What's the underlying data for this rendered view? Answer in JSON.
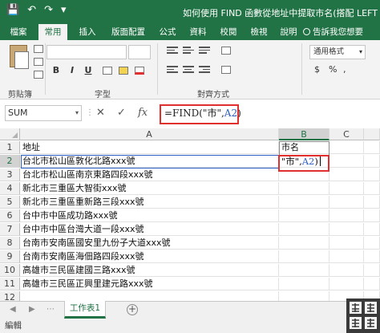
{
  "window": {
    "title": "如何使用 FIND 函數從地址中提取市名(搭配 LEFT",
    "qat_icons": [
      "save-icon",
      "undo-icon",
      "redo-icon",
      "customize-icon"
    ]
  },
  "ribbon_tabs": [
    "檔案",
    "常用",
    "插入",
    "版面配置",
    "公式",
    "資料",
    "校閱",
    "檢視",
    "說明"
  ],
  "active_tab": "常用",
  "tell_me": "告訴我您想要",
  "ribbon": {
    "groups": [
      "剪貼簿",
      "字型",
      "對齊方式"
    ],
    "number_format": "通用格式",
    "format_buttons": [
      "B",
      "I",
      "U"
    ]
  },
  "formula_bar": {
    "name_box": "SUM",
    "cancel": "✕",
    "enter": "✓",
    "fx": "fx",
    "formula_prefix": "=FIND(\"市\",",
    "formula_ref": "A2",
    "formula_suffix": ")"
  },
  "columns": [
    "A",
    "B",
    "C"
  ],
  "selected_column": "B",
  "rows": [
    {
      "n": "1",
      "a": "地址",
      "b": "市名"
    },
    {
      "n": "2",
      "a": "台北市松山區敦化北路xxx號",
      "b": ""
    },
    {
      "n": "3",
      "a": "台北市松山區南京東路四段xxx號",
      "b": ""
    },
    {
      "n": "4",
      "a": "新北市三重區大智街xxx號",
      "b": ""
    },
    {
      "n": "5",
      "a": "新北市三重區重新路三段xxx號",
      "b": ""
    },
    {
      "n": "6",
      "a": "台中市中區成功路xxx號",
      "b": ""
    },
    {
      "n": "7",
      "a": "台中市中區台灣大道一段xxx號",
      "b": ""
    },
    {
      "n": "8",
      "a": "台南市安南區國安里九份子大道xxx號",
      "b": ""
    },
    {
      "n": "9",
      "a": "台南市安南區海佃路四段xxx號",
      "b": ""
    },
    {
      "n": "10",
      "a": "高雄市三民區建國三路xxx號",
      "b": ""
    },
    {
      "n": "11",
      "a": "高雄市三民區正興里建元路xxx號",
      "b": ""
    },
    {
      "n": "12",
      "a": "",
      "b": ""
    }
  ],
  "editing_cell": {
    "prefix": "\"市\",",
    "ref": "A2",
    "suffix": ")"
  },
  "sheet_tabs": [
    "工作表1"
  ],
  "status": "編輯",
  "logo_text": "軟體羅頭",
  "colors": {
    "excel_green": "#217346",
    "highlight_red": "#e12f2f",
    "reference_blue": "#2c5fc4"
  }
}
